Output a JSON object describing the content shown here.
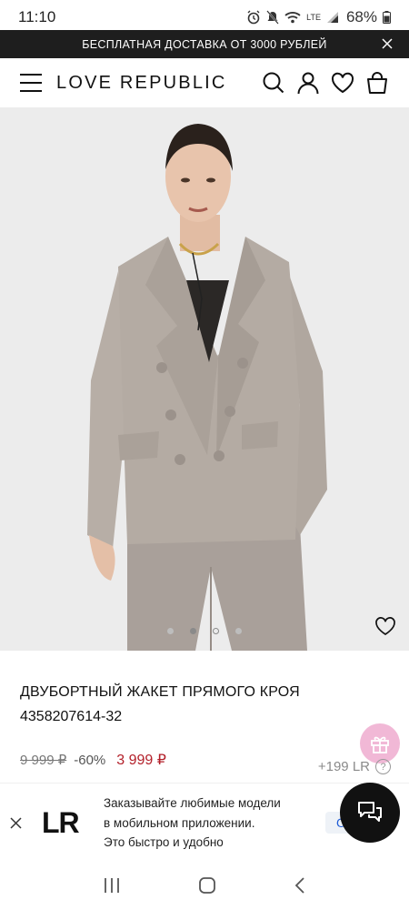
{
  "status": {
    "time": "11:10",
    "battery": "68%",
    "network": "LTE"
  },
  "promo": {
    "text": "БЕСПЛАТНАЯ ДОСТАВКА ОТ 3000 РУБЛЕЙ"
  },
  "header": {
    "logo": "LOVE REPUBLIC"
  },
  "hero": {
    "slide_count": 3,
    "active_slide": 1
  },
  "product": {
    "title": "ДВУБОРТНЫЙ ЖАКЕТ ПРЯМОГО КРОЯ",
    "sku": "4358207614-32",
    "old_price": "9 999 ₽",
    "discount": "-60%",
    "price": "3 999 ₽",
    "bonus": "+199 LR",
    "info": "?"
  },
  "app_banner": {
    "logo": "LR",
    "line1": "Заказывайте любимые модели",
    "line2": "в мобильном приложении.",
    "line3": "Это быстро и удобно",
    "button": "О"
  },
  "colors": {
    "accent_price": "#b3202a",
    "gift_bg": "#f1b8d6",
    "jacket": "#b4aba3"
  }
}
